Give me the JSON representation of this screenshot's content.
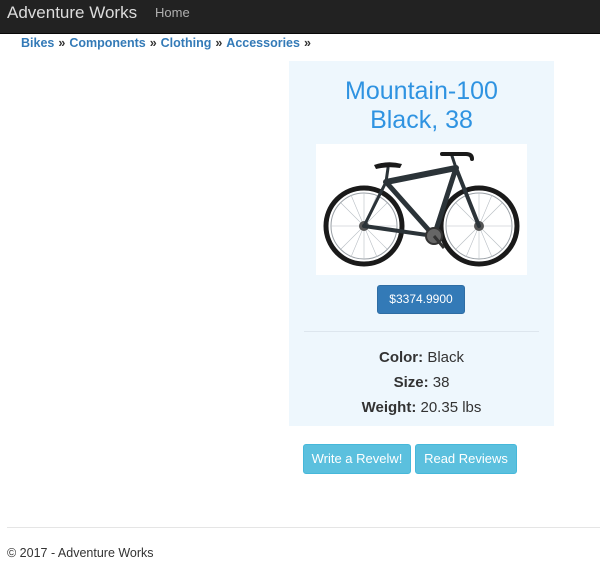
{
  "navbar": {
    "brand": "Adventure Works",
    "home_link": "Home"
  },
  "breadcrumb": {
    "items": [
      "Bikes",
      "Components",
      "Clothing",
      "Accessories"
    ],
    "separator": "»"
  },
  "product": {
    "title_line1": "Mountain-100",
    "title_line2": "Black, 38",
    "image_icon": "bicycle-image",
    "price_label": "$3374.9900",
    "color_label": "Color:",
    "color_value": "Black",
    "size_label": "Size:",
    "size_value": "38",
    "weight_label": "Weight:",
    "weight_value": "20.35 lbs"
  },
  "actions": {
    "write_review": "Write a Revelw!",
    "read_reviews": "Read Reviews"
  },
  "footer": {
    "text": "© 2017 - Adventure Works"
  },
  "colors": {
    "navbar_bg": "#222222",
    "link": "#337ab7",
    "title": "#2f93e1",
    "card_bg": "#eef7fd",
    "primary_button": "#337ab7",
    "info_button": "#5bc0de"
  }
}
